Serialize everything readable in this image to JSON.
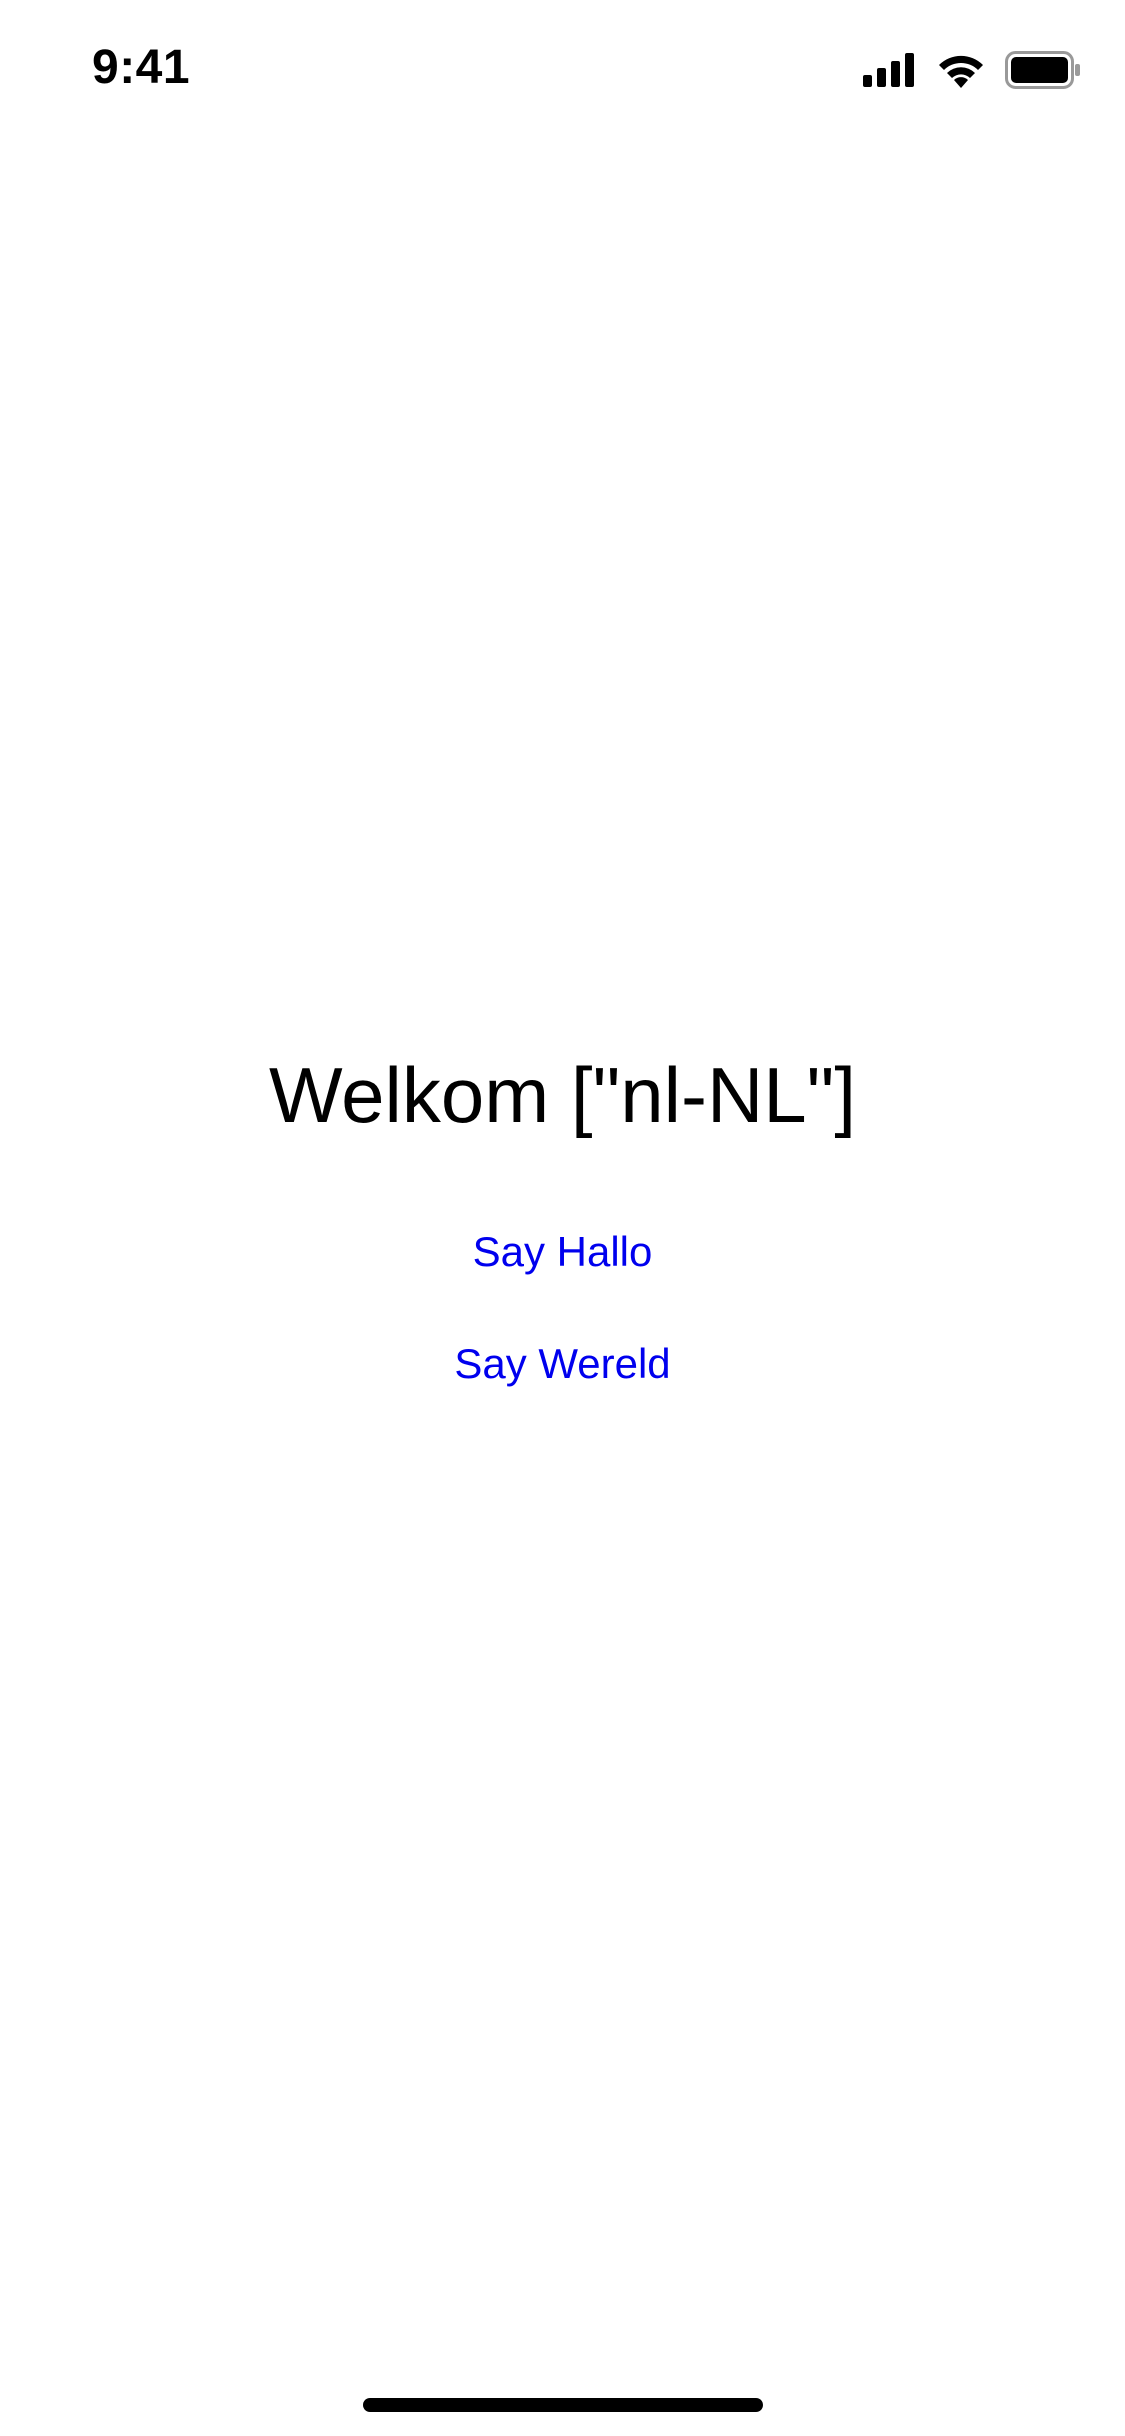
{
  "status_bar": {
    "time": "9:41",
    "icons": [
      "cellular-signal-icon",
      "wifi-icon",
      "battery-icon"
    ]
  },
  "main": {
    "title": "Welkom [\"nl-NL\"]",
    "buttons": [
      {
        "label": "Say Hallo"
      },
      {
        "label": "Say Wereld"
      }
    ]
  },
  "colors": {
    "background": "#ffffff",
    "text": "#000000",
    "link": "#0000ee"
  }
}
